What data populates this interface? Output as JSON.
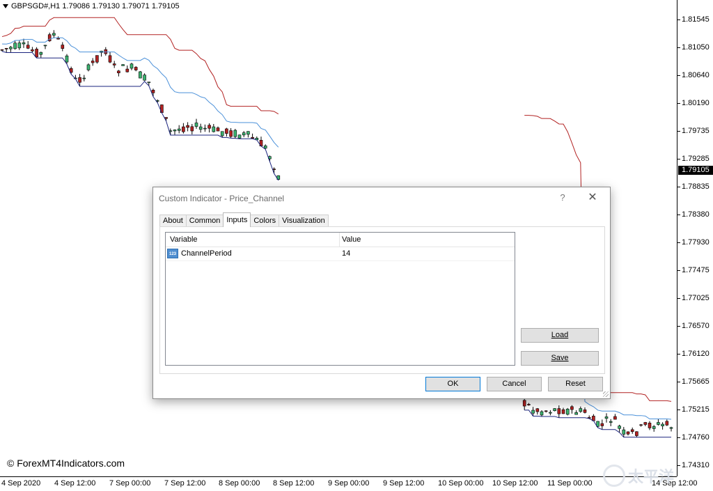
{
  "chart": {
    "symbol_info": "GBPSGD#,H1  1.79086 1.79130 1.79071 1.79105",
    "price_min": 1.7425,
    "price_max": 1.8191,
    "price_labels": [
      "1.81545",
      "1.81050",
      "1.80640",
      "1.80190",
      "1.79735",
      "1.79285",
      "1.78835",
      "1.78380",
      "1.77930",
      "1.77475",
      "1.77025",
      "1.76570",
      "1.76120",
      "1.75665",
      "1.75215",
      "1.74760",
      "1.74310"
    ],
    "current_price": "1.79105",
    "time_labels": [
      "4 Sep 2020",
      "4 Sep 12:00",
      "7 Sep 00:00",
      "7 Sep 12:00",
      "8 Sep 00:00",
      "8 Sep 12:00",
      "9 Sep 00:00",
      "9 Sep 12:00",
      "10 Sep 00:00",
      "10 Sep 12:00",
      "11 Sep 00:00",
      "14 Sep 12:00"
    ],
    "colors": {
      "bull": "#3cb371",
      "bear": "#b22222",
      "upper": "#b22222",
      "middle": "#4a90d9",
      "lower": "#1a237e"
    },
    "copyright": "© ForexMT4Indicators.com",
    "watermark": "太平洋"
  },
  "dialog": {
    "title": "Custom Indicator - Price_Channel",
    "help": "?",
    "close": "✕",
    "tabs": [
      "About",
      "Common",
      "Inputs",
      "Colors",
      "Visualization"
    ],
    "active_tab": "Inputs",
    "table": {
      "headers": [
        "Variable",
        "Value"
      ],
      "rows": [
        {
          "icon": "123",
          "variable": "ChannelPeriod",
          "value": "14"
        }
      ]
    },
    "buttons": {
      "load": "Load",
      "save": "Save",
      "ok": "OK",
      "cancel": "Cancel",
      "reset": "Reset"
    }
  }
}
